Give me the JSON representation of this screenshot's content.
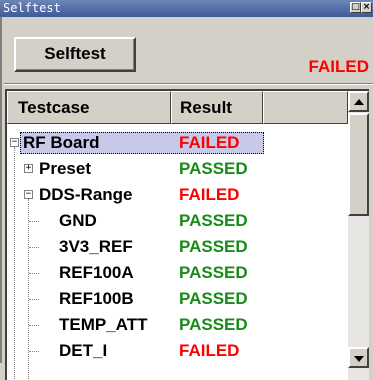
{
  "window": {
    "title": "Selftest",
    "maximize_icon": "□",
    "close_icon": "×"
  },
  "toolbar": {
    "selftest_label": "Selftest",
    "overall_status": "FAILED"
  },
  "table": {
    "columns": [
      "Testcase",
      "Result",
      ""
    ],
    "rows": [
      {
        "name": "RF Board",
        "result": "FAILED",
        "level": 0,
        "expander": "−",
        "selected": true
      },
      {
        "name": "Preset",
        "result": "PASSED",
        "level": 1,
        "expander": "+"
      },
      {
        "name": "DDS-Range",
        "result": "FAILED",
        "level": 1,
        "expander": "−"
      },
      {
        "name": "GND",
        "result": "PASSED",
        "level": 2
      },
      {
        "name": "3V3_REF",
        "result": "PASSED",
        "level": 2
      },
      {
        "name": "REF100A",
        "result": "PASSED",
        "level": 2
      },
      {
        "name": "REF100B",
        "result": "PASSED",
        "level": 2
      },
      {
        "name": "TEMP_ATT",
        "result": "PASSED",
        "level": 2
      },
      {
        "name": "DET_I",
        "result": "FAILED",
        "level": 2
      }
    ]
  },
  "colors": {
    "passed": "#1a8a1a",
    "failed": "#ff0000",
    "selection": "#c8c8e8"
  }
}
